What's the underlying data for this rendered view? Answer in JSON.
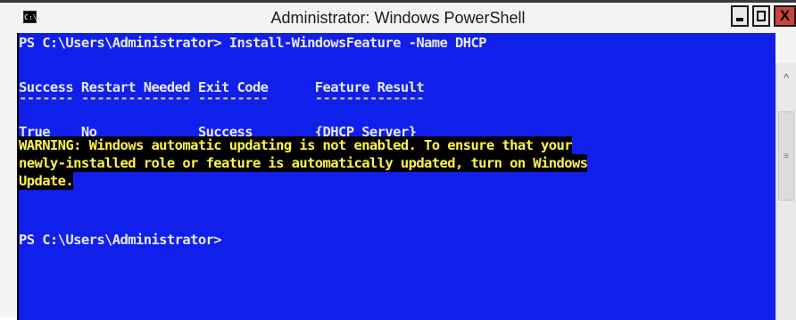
{
  "window": {
    "title": "Administrator: Windows PowerShell",
    "icon_label": "C:\\.",
    "minimize_icon": "minimize-icon",
    "maximize_icon": "maximize-icon",
    "close_label": "X"
  },
  "console": {
    "colors": {
      "background": "#1020ea",
      "text": "#e8e8e8",
      "warning_bg": "#000000",
      "warning_fg": "#fff34a"
    },
    "prompt_line": "PS C:\\Users\\Administrator> Install-WindowsFeature -Name DHCP",
    "table_headers": "Success Restart Needed Exit Code      Feature Result",
    "table_dashes": "------- -------------- ---------      --------------",
    "table_row": "True    No             Success        {DHCP Server}",
    "warning_lines": [
      "WARNING: Windows automatic updating is not enabled. To ensure that your",
      "newly-installed role or feature is automatically updated, turn on Windows",
      "Update."
    ],
    "final_prompt": "PS C:\\Users\\Administrator>"
  },
  "scrollbar": {
    "up_arrow": "^",
    "thumb_grip": "≡"
  }
}
